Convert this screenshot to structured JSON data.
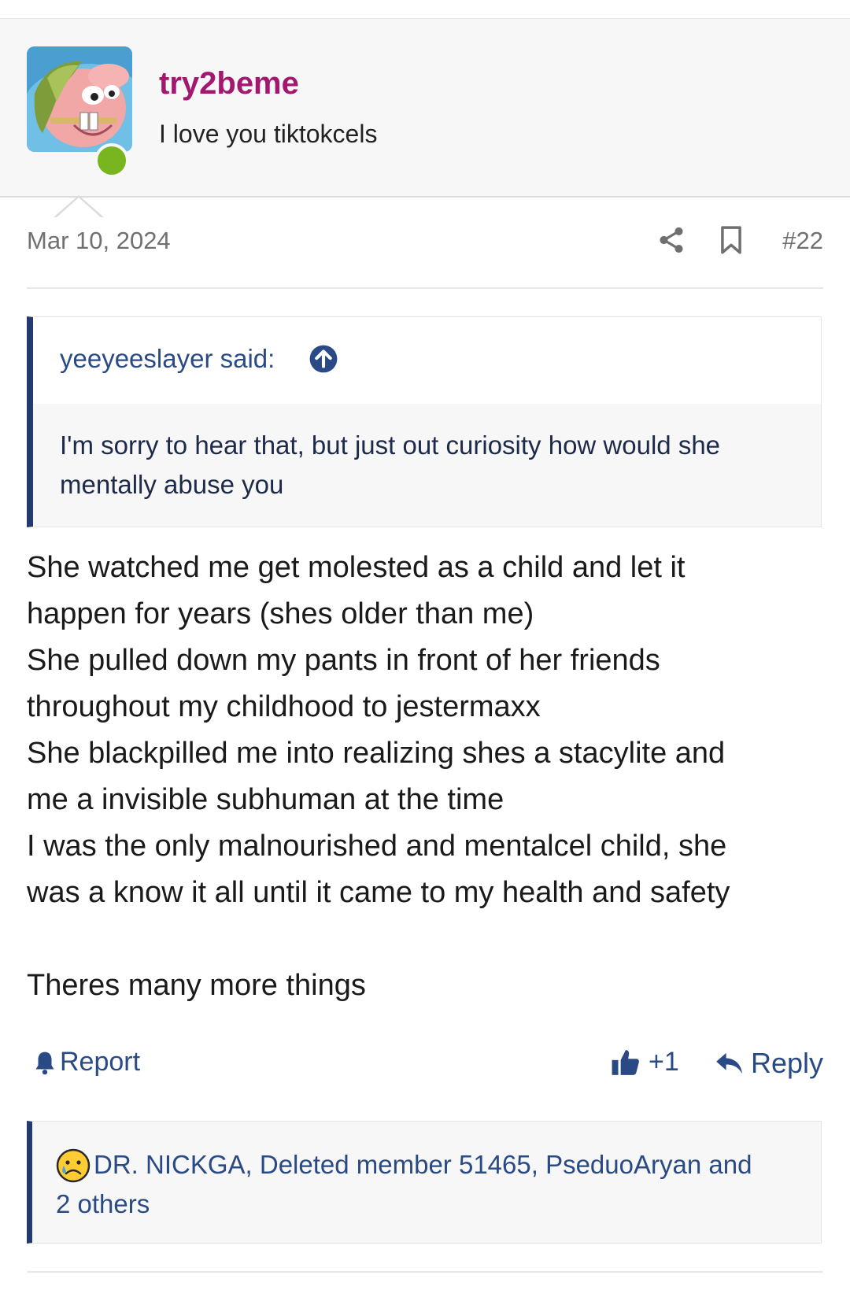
{
  "post": {
    "username": "try2beme",
    "user_title": "I love you tiktokcels",
    "date": "Mar 10, 2024",
    "post_number": "#22",
    "quote": {
      "author": "yeeyeeslayer said:",
      "text": "I'm sorry to hear that, but just out curiosity how would she mentally abuse you"
    },
    "body_lines": [
      "She watched me get molested as a child and let it",
      "happen for years (shes older than me)",
      "She pulled down my pants in front of her friends",
      "throughout my childhood to jestermaxx",
      "She blackpilled me into realizing shes a stacylite and",
      "me a invisible subhuman at the time",
      "I was the only malnourished and mentalcel child, she",
      "was a know it all until it came to my health and safety",
      "",
      "Theres many more things"
    ],
    "actions": {
      "report_label": "Report",
      "like_count": "+1",
      "reply_label": "Reply"
    },
    "reactions": {
      "text": "DR. NICKGA, Deleted member 51465, PseduoAryan and 2 others",
      "emoji": "sad-face-icon"
    }
  },
  "colors": {
    "username": "#a3176f",
    "link": "#2a4a86",
    "quote_border": "#253a6e",
    "online": "#78b51e"
  }
}
